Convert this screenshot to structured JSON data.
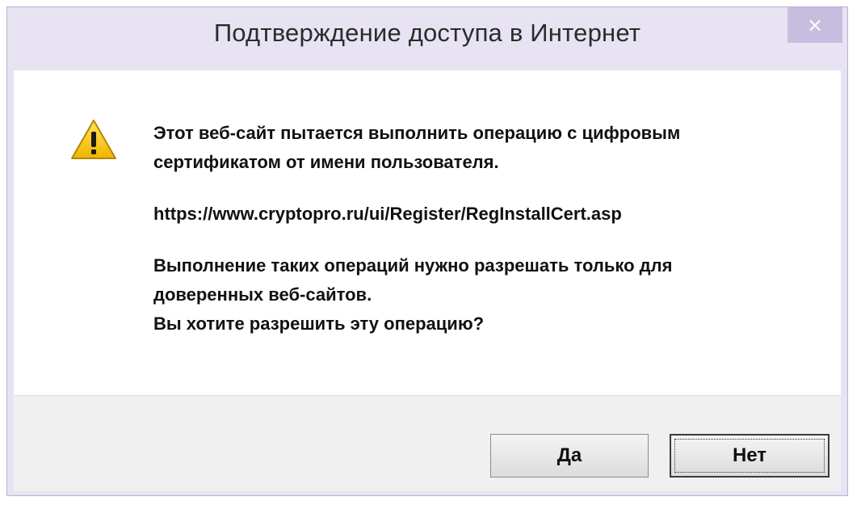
{
  "dialog": {
    "title": "Подтверждение доступа в Интернет",
    "close_glyph": "×",
    "icon": "warning-icon",
    "message": {
      "line1": "Этот веб-сайт пытается выполнить операцию с цифровым",
      "line2": "сертификатом от имени пользователя.",
      "url": "https://www.cryptopro.ru/ui/Register/RegInstallCert.asp",
      "line3": "Выполнение таких операций нужно разрешать только для",
      "line4": "доверенных веб-сайтов.",
      "line5": "Вы хотите разрешить эту операцию?"
    },
    "buttons": {
      "yes_label": "Да",
      "no_label": "Нет"
    }
  },
  "colors": {
    "frame": "#e7e3f2",
    "close_button": "#c7bedf",
    "warning_yellow": "#f5c400"
  }
}
